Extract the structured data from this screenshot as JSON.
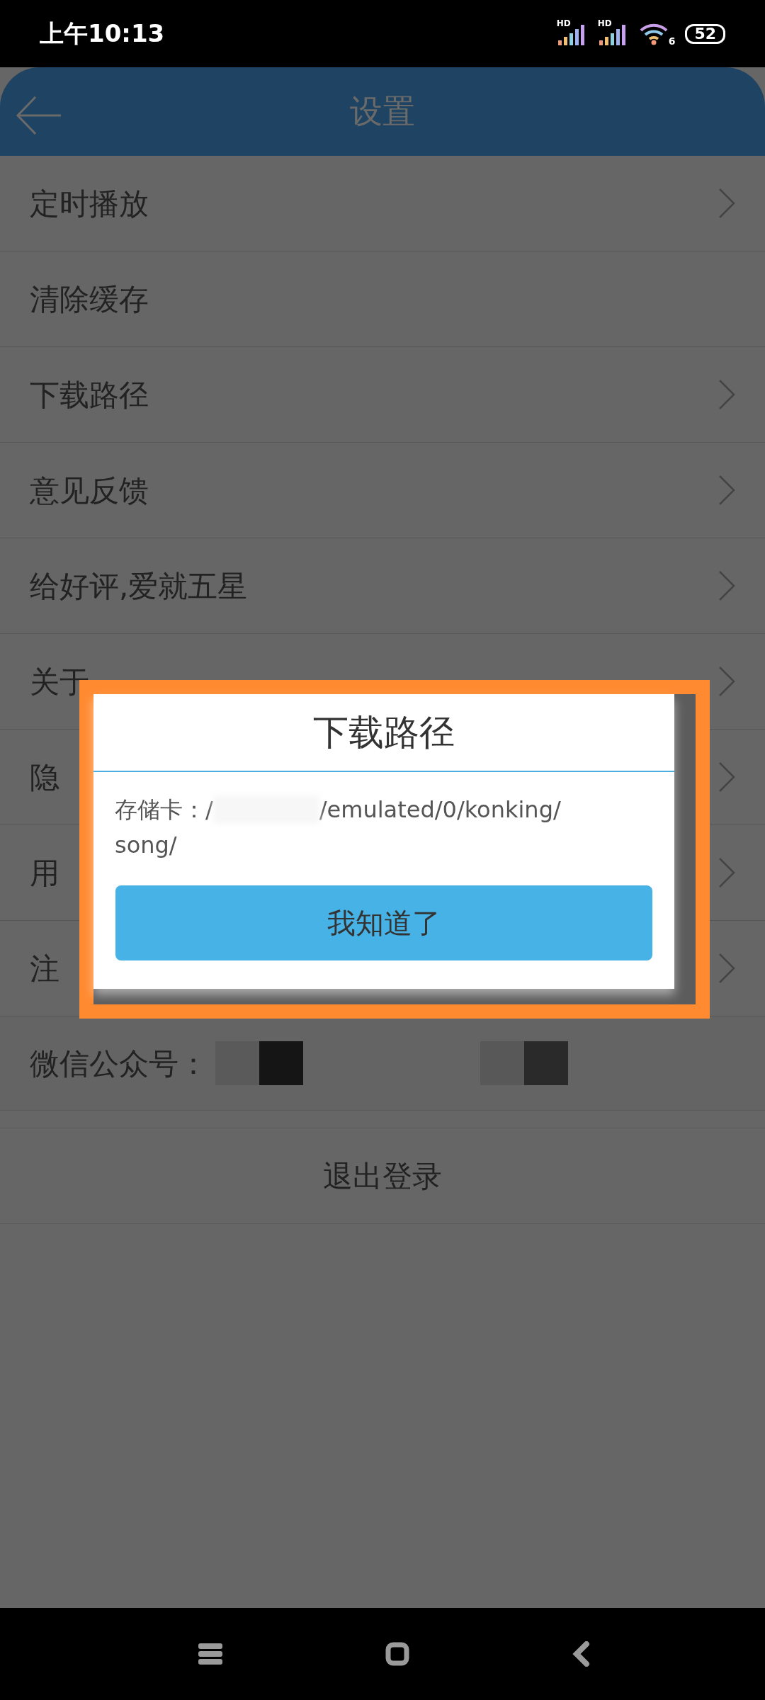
{
  "status_bar": {
    "time": "上午10:13",
    "signal_labels": [
      "HD",
      "HD"
    ],
    "wifi_label": "6",
    "battery": "52"
  },
  "header": {
    "title": "设置"
  },
  "settings": [
    {
      "label": "定时播放",
      "chevron": true
    },
    {
      "label": "清除缓存",
      "chevron": false
    },
    {
      "label": "下载路径",
      "chevron": true
    },
    {
      "label": "意见反馈",
      "chevron": true
    },
    {
      "label": "给好评,爱就五星",
      "chevron": true
    },
    {
      "label": "关于",
      "chevron": true
    },
    {
      "label": "隐",
      "chevron": true
    },
    {
      "label": "用",
      "chevron": true
    },
    {
      "label": "注",
      "chevron": true
    }
  ],
  "wechat": {
    "label": "微信公众号："
  },
  "logout": {
    "label": "退出登录"
  },
  "dialog": {
    "title": "下载路径",
    "path_prefix": "存储卡：/",
    "path_lines": [
      "/emulated/0/konking/",
      "song/"
    ],
    "button": "我知道了"
  }
}
